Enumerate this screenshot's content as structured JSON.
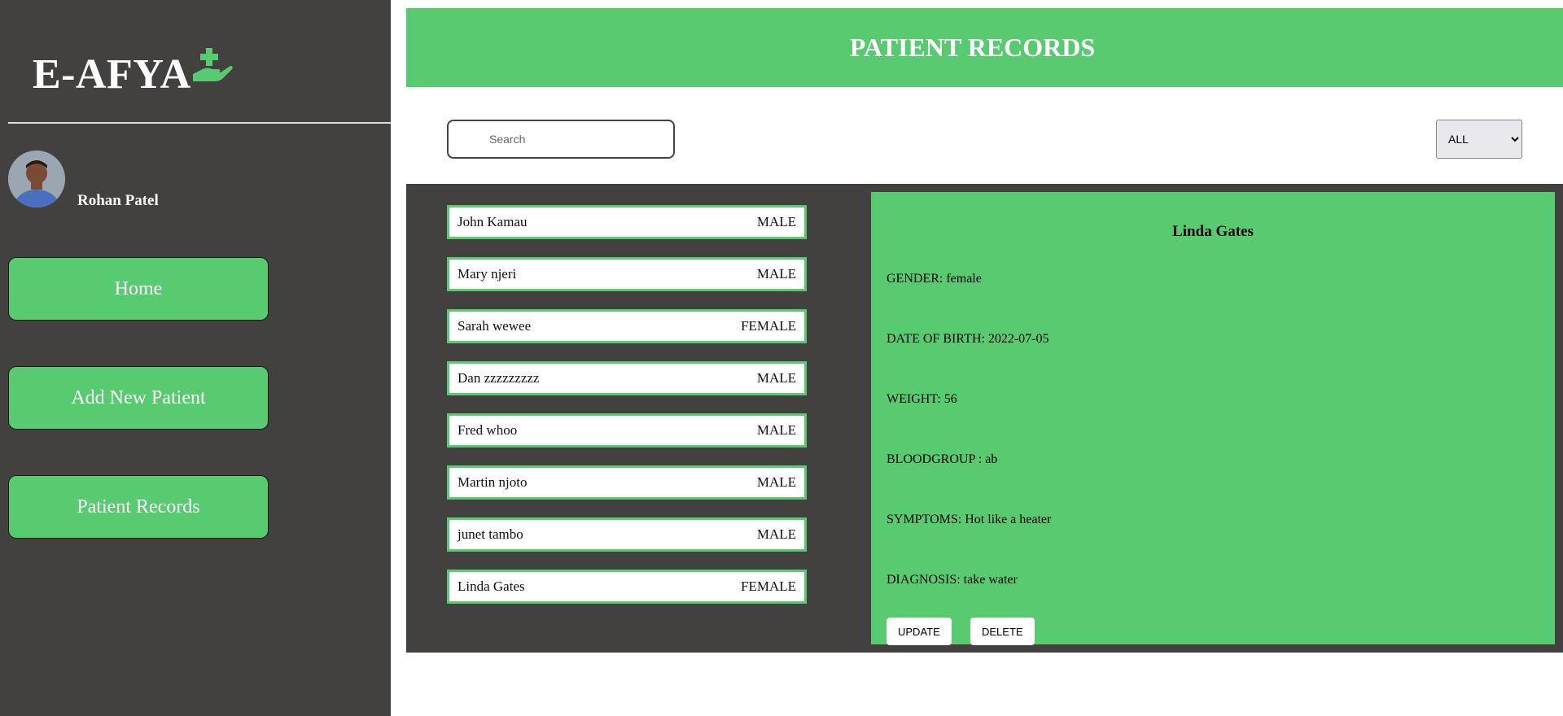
{
  "app": {
    "brand": "E-AFYA",
    "accent_color": "#58ca70",
    "sidebar_color": "#434040",
    "user_name": "Rohan Patel"
  },
  "nav": {
    "home": "Home",
    "add_patient": "Add New Patient",
    "records": "Patient Records"
  },
  "header": {
    "title": "PATIENT RECORDS"
  },
  "search": {
    "placeholder": "Search"
  },
  "filter": {
    "selected": "ALL"
  },
  "patients": [
    {
      "name": "John Kamau",
      "gender": "MALE"
    },
    {
      "name": "Mary njeri",
      "gender": "MALE"
    },
    {
      "name": "Sarah wewee",
      "gender": "FEMALE"
    },
    {
      "name": "Dan zzzzzzzzz",
      "gender": "MALE"
    },
    {
      "name": "Fred whoo",
      "gender": "MALE"
    },
    {
      "name": "Martin njoto",
      "gender": "MALE"
    },
    {
      "name": "junet tambo",
      "gender": "MALE"
    },
    {
      "name": "Linda Gates",
      "gender": "FEMALE"
    }
  ],
  "detail": {
    "name": "Linda Gates",
    "gender": "GENDER: female",
    "dob": "DATE OF BIRTH: 2022-07-05",
    "weight": "WEIGHT: 56",
    "bloodgroup": "BLOODGROUP : ab",
    "symptoms": "SYMPTOMS: Hot like a heater",
    "diagnosis": "DIAGNOSIS: take water",
    "update_label": "UPDATE",
    "delete_label": "DELETE"
  }
}
